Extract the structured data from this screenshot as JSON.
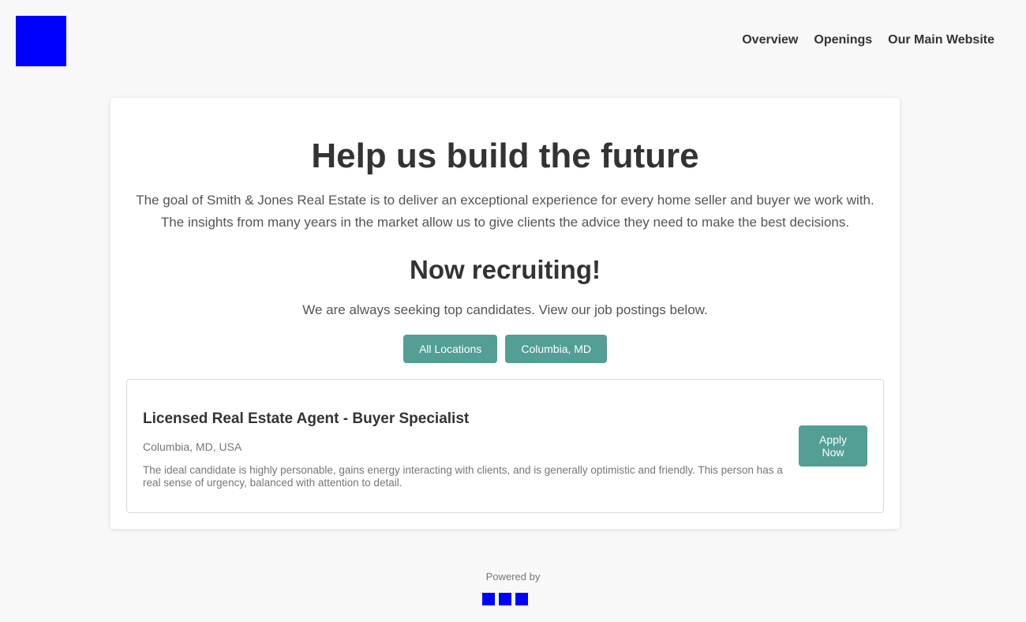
{
  "header": {
    "logo_icon": "company-logo-icon",
    "logo_color": "#0000ff",
    "nav": [
      "Overview",
      "Openings",
      "Our Main Website"
    ]
  },
  "hero": {
    "title": "Help us build the future",
    "text": "The goal of Smith & Jones Real Estate is to deliver an exceptional experience for every home seller and buyer we work with. The insights from many years in the market allow us to give clients the advice they need to make the best decisions."
  },
  "recruiting": {
    "title": "Now recruiting!",
    "text": "We are always seeking top candidates. View our job postings below.",
    "filters": [
      "All Locations",
      "Columbia, MD"
    ]
  },
  "jobs": [
    {
      "title": "Licensed Real Estate Agent - Buyer Specialist",
      "location": "Columbia, MD, USA",
      "description": "The ideal candidate is highly personable, gains energy interacting with clients, and is generally optimistic and friendly. This person has a real sense of urgency, balanced with attention to detail.",
      "apply_label": "Apply Now"
    }
  ],
  "footer": {
    "powered_by": "Powered by",
    "logo_icon": "powered-by-logo-icon"
  },
  "colors": {
    "accent": "#539e95",
    "background": "#f8f8f8",
    "text": "#333333",
    "muted": "#777777"
  }
}
